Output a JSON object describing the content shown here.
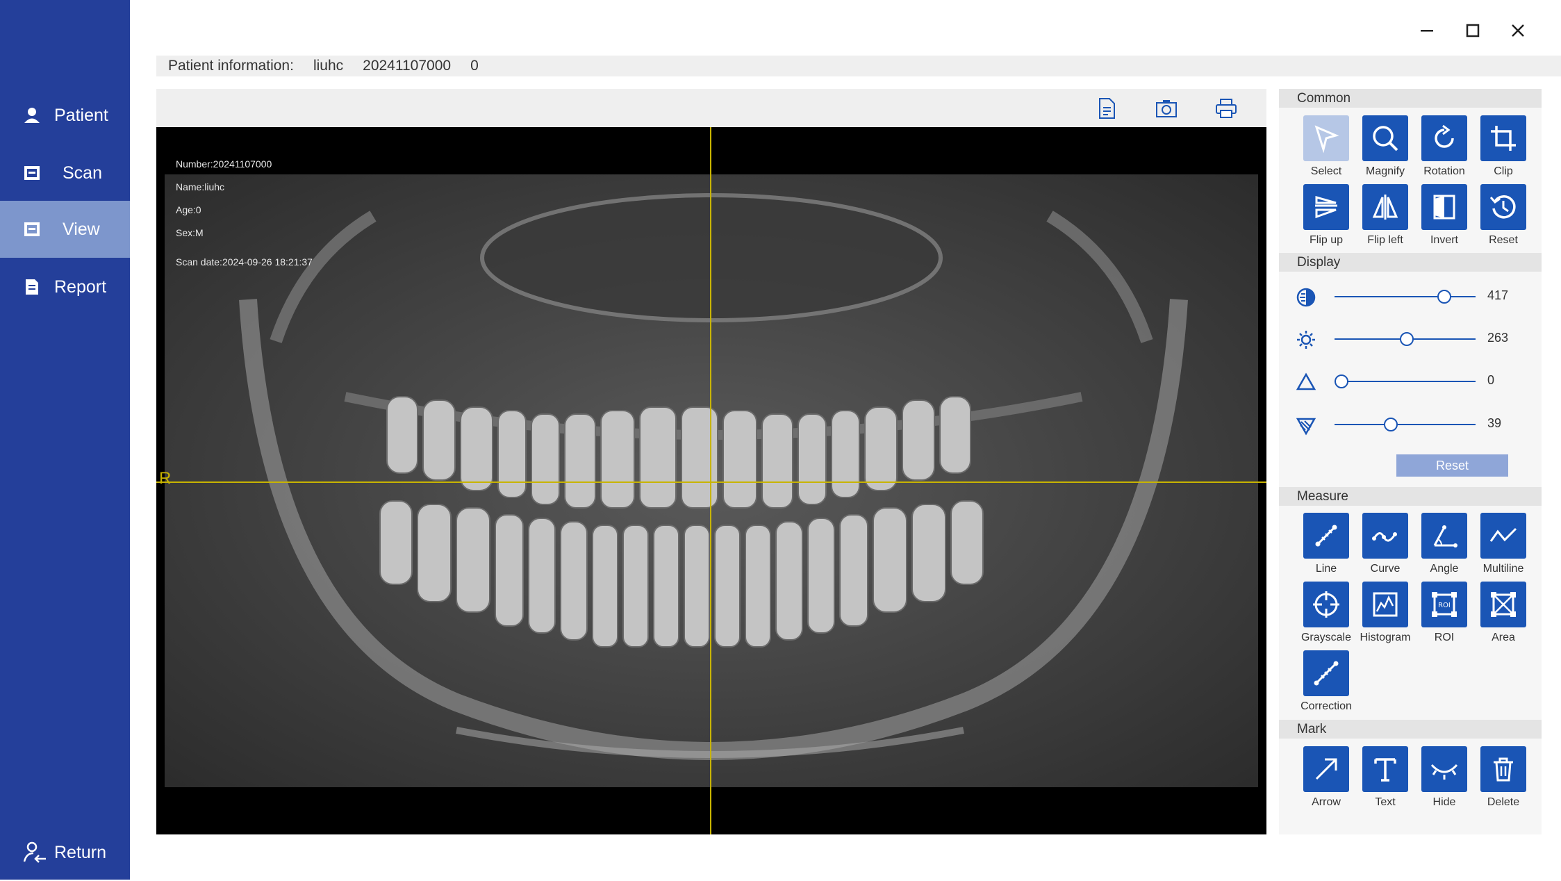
{
  "nav": {
    "items": [
      {
        "label": "Patient",
        "icon": "user-icon"
      },
      {
        "label": "Scan",
        "icon": "scan-icon"
      },
      {
        "label": "View",
        "icon": "view-icon",
        "active": true
      },
      {
        "label": "Report",
        "icon": "report-icon"
      }
    ],
    "return_label": "Return"
  },
  "window": {
    "controls": [
      "minimize-icon",
      "maximize-icon",
      "close-icon"
    ]
  },
  "patient_info": {
    "label": "Patient information:",
    "name": "liuhc",
    "number": "20241107000",
    "extra": "0"
  },
  "viewer": {
    "toolbar": [
      "document-icon",
      "camera-icon",
      "print-icon"
    ],
    "overlay": {
      "number": "Number:20241107000",
      "name": "Name:liuhc",
      "age": "Age:0",
      "sex": "Sex:M",
      "scan_date": "Scan date:2024-09-26 18:21:37"
    },
    "side_marker": "R",
    "crosshair_color": "#c8b400"
  },
  "panel": {
    "common": {
      "title": "Common",
      "tools": [
        {
          "label": "Select",
          "active": true
        },
        {
          "label": "Magnify"
        },
        {
          "label": "Rotation"
        },
        {
          "label": "Clip"
        },
        {
          "label": "Flip up"
        },
        {
          "label": "Flip left"
        },
        {
          "label": "Invert"
        },
        {
          "label": "Reset"
        }
      ]
    },
    "display": {
      "title": "Display",
      "sliders": [
        {
          "icon": "contrast-icon",
          "value": "417",
          "fraction": 0.78
        },
        {
          "icon": "brightness-icon",
          "value": "263",
          "fraction": 0.51
        },
        {
          "icon": "gamma-icon",
          "value": "0",
          "fraction": 0.05
        },
        {
          "icon": "sharpness-icon",
          "value": "39",
          "fraction": 0.4
        }
      ],
      "reset_label": "Reset"
    },
    "measure": {
      "title": "Measure",
      "tools": [
        {
          "label": "Line"
        },
        {
          "label": "Curve"
        },
        {
          "label": "Angle"
        },
        {
          "label": "Multiline"
        },
        {
          "label": "Grayscale"
        },
        {
          "label": "Histogram"
        },
        {
          "label": "ROI"
        },
        {
          "label": "Area"
        },
        {
          "label": "Correction"
        }
      ]
    },
    "mark": {
      "title": "Mark",
      "tools": [
        {
          "label": "Arrow"
        },
        {
          "label": "Text"
        },
        {
          "label": "Hide"
        },
        {
          "label": "Delete"
        }
      ]
    }
  },
  "colors": {
    "sidebar": "#243f9a",
    "accent": "#1a55b5",
    "active_nav": "#7d96cc"
  }
}
